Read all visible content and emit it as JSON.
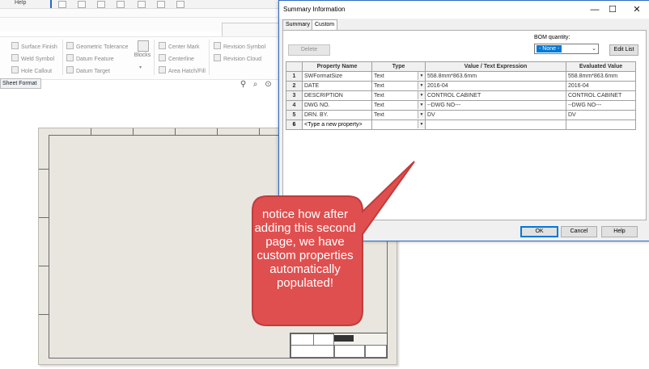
{
  "background_app": {
    "menu_help": "Help",
    "annotation_tools": {
      "col1": [
        "Surface Finish",
        "Weld Symbol",
        "Hole Callout"
      ],
      "col2": [
        "Geometric Tolerance",
        "Datum Feature",
        "Datum Target"
      ],
      "blocks": "Blocks",
      "col3": [
        "Center Mark",
        "Centerline",
        "Area Hatch/Fill"
      ],
      "col4": [
        "Revision Symbol",
        "Revision Cloud"
      ]
    },
    "sheet_format_tab": "Sheet Format"
  },
  "dialog": {
    "title": "Summary Information",
    "minimize": "—",
    "maximize": "☐",
    "close": "✕",
    "tabs": [
      {
        "label": "Summary",
        "active": false
      },
      {
        "label": "Custom",
        "active": true
      }
    ],
    "delete_label": "Delete",
    "bom_label": "BOM quantity:",
    "bom_value": "- None -",
    "edit_list_label": "Edit List",
    "table": {
      "headers": [
        "",
        "Property Name",
        "Type",
        "Value / Text Expression",
        "Evaluated Value"
      ],
      "rows": [
        {
          "num": "1",
          "name": "SWFormatSize",
          "type": "Text",
          "value": "558.8mm*863.6mm",
          "evaluated": "558.8mm*863.6mm"
        },
        {
          "num": "2",
          "name": "DATE",
          "type": "Text",
          "value": "2016-04",
          "evaluated": "2016-04"
        },
        {
          "num": "3",
          "name": "DESCRIPTION",
          "type": "Text",
          "value": "CONTROL CABINET",
          "evaluated": "CONTROL CABINET"
        },
        {
          "num": "4",
          "name": "DWG NO.",
          "type": "Text",
          "value": "--DWG NO---",
          "evaluated": "--DWG NO---"
        },
        {
          "num": "5",
          "name": "DRN. BY.",
          "type": "Text",
          "value": "DV",
          "evaluated": "DV"
        },
        {
          "num": "6",
          "name": "<Type a new property>",
          "type": "",
          "value": "",
          "evaluated": ""
        }
      ]
    },
    "ok_label": "OK",
    "cancel_label": "Cancel",
    "help_label": "Help"
  },
  "callout": {
    "text": "notice how after adding this second page, we have custom properties automatically populated!",
    "fill": "#e04f4f",
    "stroke": "#c03c3c"
  },
  "colors": {
    "accent": "#0078d7",
    "sheet": "#e8e6df"
  }
}
